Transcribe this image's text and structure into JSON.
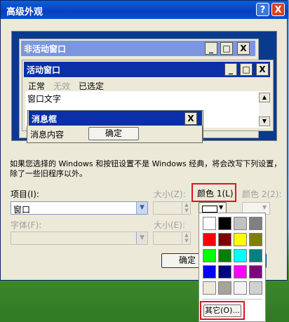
{
  "window": {
    "title": "高级外观",
    "help_label": "?",
    "close_label": "X"
  },
  "preview": {
    "inactive_title": "非活动窗口",
    "active_title": "活动窗口",
    "menu_items": [
      "正常",
      "无效",
      "已选定"
    ],
    "window_text": "窗口文字",
    "msgbox_title": "消息框",
    "msgbox_text": "消息内容",
    "ok_label": "确定",
    "minimize_glyph": "_",
    "maximize_glyph": "□",
    "close_glyph": "X"
  },
  "notice": "如果您选择的 Windows 和按钮设置不是 Windows 经典，将会改写下列设置，除了一些旧程序以外。",
  "item": {
    "label": "项目(I):",
    "value": "窗口"
  },
  "size1": {
    "label": "大小(Z):"
  },
  "color1": {
    "label": "颜色 1(L)"
  },
  "color2": {
    "label": "颜色 2(2):"
  },
  "font": {
    "label": "字体(F):"
  },
  "size2": {
    "label": "大小(E):"
  },
  "ok_button": "确定",
  "palette": {
    "colors": [
      "#ffffff",
      "#000000",
      "#c0c0c0",
      "#808080",
      "#ff0000",
      "#800000",
      "#ffff00",
      "#808000",
      "#00ff00",
      "#008000",
      "#00ffff",
      "#008080",
      "#0000ff",
      "#000080",
      "#ff00ff",
      "#800080",
      "#ece9d8",
      "#a6a39a",
      "#f2f2f2",
      "#d0d0d0"
    ],
    "other_label": "其它(O)..."
  }
}
